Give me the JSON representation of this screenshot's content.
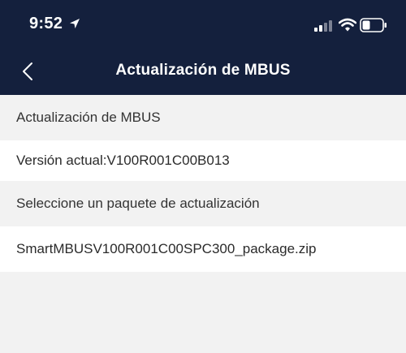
{
  "status_bar": {
    "time": "9:52",
    "icons": [
      "location-arrow-icon",
      "signal-icon",
      "wifi-icon",
      "battery-icon"
    ]
  },
  "nav": {
    "back_icon": "chevron-left-icon",
    "title": "Actualización de MBUS"
  },
  "sections": {
    "update_title": "Actualización de MBUS",
    "current_version_label": "Versión actual:",
    "current_version_value": "V100R001C00B013",
    "package_title": "Seleccione un paquete de actualización",
    "package_file": "SmartMBUSV100R001C00SPC300_package.zip"
  },
  "colors": {
    "header_bg": "#14203d",
    "page_bg": "#f2f2f2",
    "row_bg": "#ffffff"
  }
}
